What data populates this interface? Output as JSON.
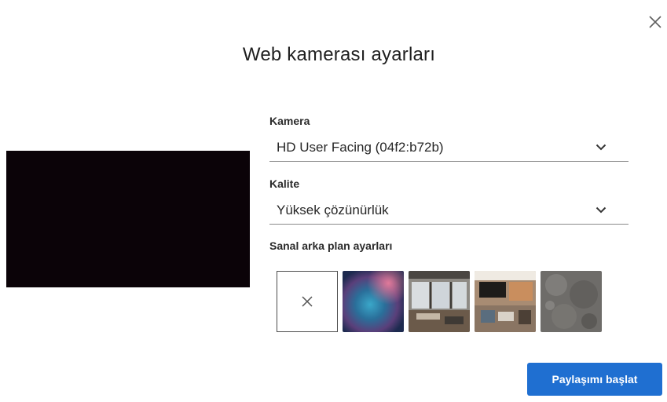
{
  "dialog": {
    "title": "Web kamerası ayarları",
    "close_icon": "close-icon"
  },
  "camera": {
    "label": "Kamera",
    "selected": "HD User Facing (04f2:b72b)",
    "chevron_icon": "chevron-down-icon"
  },
  "quality": {
    "label": "Kalite",
    "selected": "Yüksek çözünürlük",
    "chevron_icon": "chevron-down-icon"
  },
  "virtual_background": {
    "label": "Sanal arka plan ayarları",
    "options": [
      {
        "name": "none",
        "icon": "close-icon"
      },
      {
        "name": "blur"
      },
      {
        "name": "room-1"
      },
      {
        "name": "room-2"
      },
      {
        "name": "texture"
      }
    ]
  },
  "actions": {
    "start_share_label": "Paylaşımı başlat"
  },
  "colors": {
    "primary_button": "#1f6fd1",
    "preview_bg": "#0b0308"
  }
}
